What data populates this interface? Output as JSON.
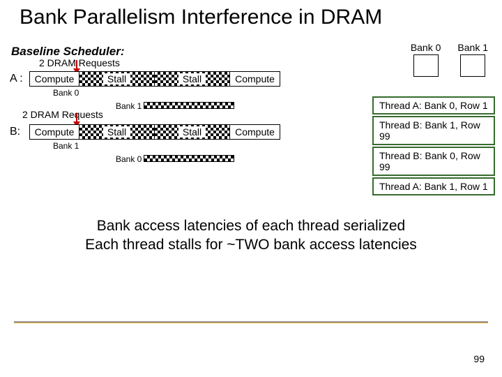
{
  "title": "Bank Parallelism Interference in DRAM",
  "subtitle": "Baseline Scheduler:",
  "labels": {
    "req_a": "2 DRAM Requests",
    "req_b": "2 DRAM Requests",
    "thread_a": "A :",
    "thread_b": "B:",
    "compute": "Compute",
    "stall": "Stall",
    "bank0": "Bank 0",
    "bank1": "Bank 1"
  },
  "banks": {
    "b0": "Bank 0",
    "b1": "Bank 1"
  },
  "queue": [
    "Thread A: Bank 0, Row 1",
    "Thread B: Bank 1, Row 99",
    "Thread B: Bank 0, Row 99",
    "Thread A: Bank 1, Row 1"
  ],
  "summary_l1": "Bank access latencies of each thread serialized",
  "summary_l2": "Each thread stalls for ~TWO bank access latencies",
  "page": "99",
  "chart_data": {
    "type": "diagram",
    "banks": [
      "Bank 0",
      "Bank 1"
    ],
    "threads": {
      "A": {
        "pipeline": [
          "Compute",
          "Stall",
          "Stall",
          "Compute"
        ],
        "requests": [
          {
            "target": "Bank 0",
            "arrow_after_segment": 0
          },
          {
            "target": "Bank 1",
            "note_below": "2 DRAM Requests"
          }
        ]
      },
      "B": {
        "pipeline": [
          "Compute",
          "Stall",
          "Stall",
          "Compute"
        ],
        "requests": [
          {
            "target": "Bank 1",
            "arrow_after_segment": 0
          },
          {
            "target": "Bank 0"
          }
        ]
      }
    },
    "bank_service_order": [
      "Thread A: Bank 0, Row 1",
      "Thread B: Bank 1, Row 99",
      "Thread B: Bank 0, Row 99",
      "Thread A: Bank 1, Row 1"
    ],
    "conclusion": "Bank access latencies of each thread serialized; each thread stalls for ~TWO bank access latencies"
  }
}
